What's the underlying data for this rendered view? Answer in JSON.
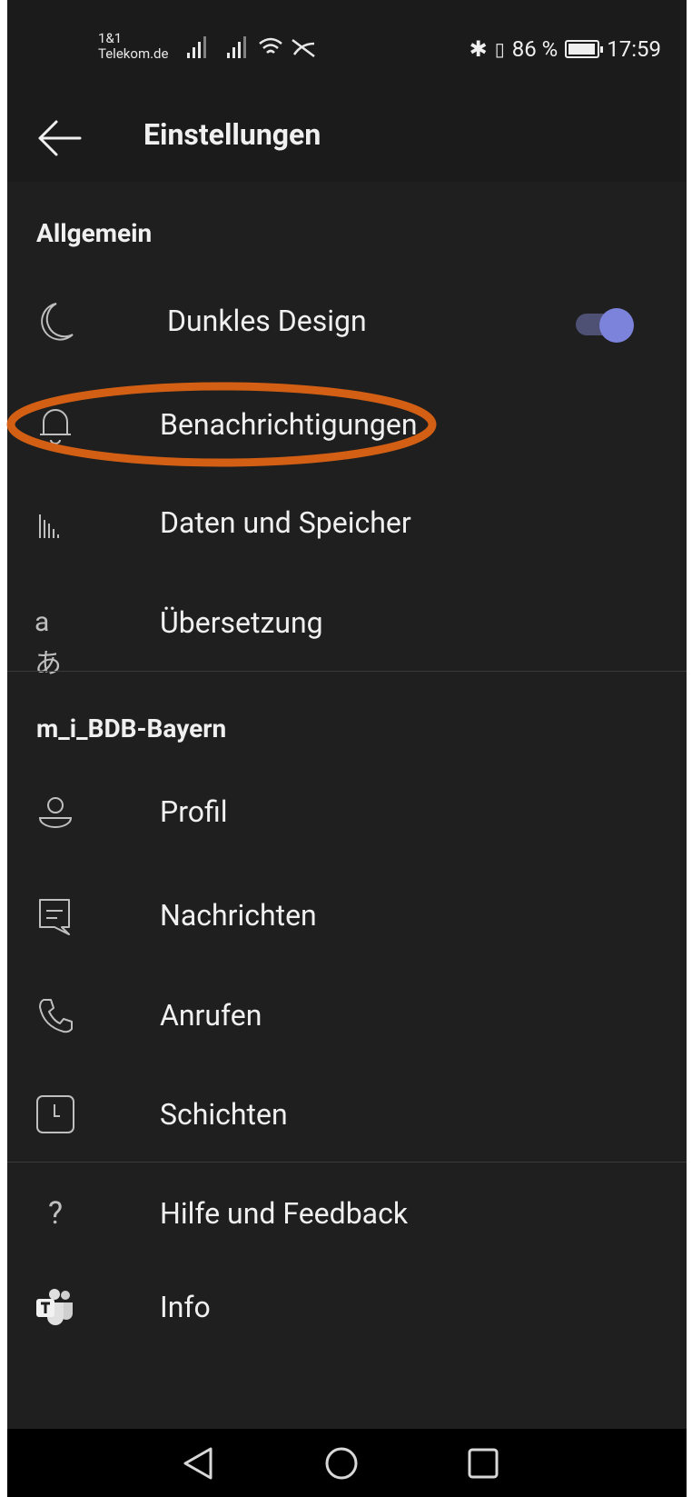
{
  "statusbar": {
    "carrier_line1": "1&1",
    "carrier_line2": "Telekom.de",
    "battery_text": "86 %",
    "time": "17:59",
    "battery_level": 0.86
  },
  "header": {
    "title": "Einstellungen"
  },
  "general": {
    "title": "Allgemein",
    "items": [
      {
        "label": "Dunkles Design",
        "icon": "moon-icon"
      },
      {
        "label": "Benachrichtigungen",
        "icon": "bell-icon"
      },
      {
        "label": "Daten und Speicher",
        "icon": "data-icon"
      },
      {
        "label": "Übersetzung",
        "icon": "translate-icon"
      }
    ],
    "dark_mode_on": true
  },
  "org": {
    "title": "m_i_BDB-Bayern",
    "items": [
      {
        "label": "Profil",
        "icon": "person-icon"
      },
      {
        "label": "Nachrichten",
        "icon": "chat-icon"
      },
      {
        "label": "Anrufen",
        "icon": "phone-icon"
      },
      {
        "label": "Schichten",
        "icon": "clock-icon"
      }
    ]
  },
  "more": {
    "items": [
      {
        "label": "Hilfe und Feedback",
        "icon": "help-icon"
      },
      {
        "label": "Info",
        "icon": "teams-logo-icon"
      }
    ]
  },
  "colors": {
    "background": "#1f1f1f",
    "accent": "#7b83db",
    "annotation": "#d35f14"
  }
}
